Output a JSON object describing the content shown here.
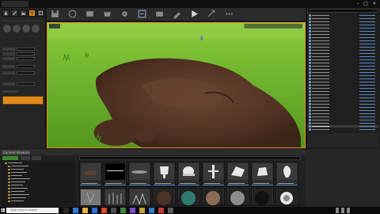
{
  "window": {
    "tab_label": "",
    "buttons": [
      "minimize",
      "maximize",
      "close"
    ]
  },
  "modes_panel": {
    "mode_icons": [
      "place-icon",
      "paint-icon",
      "landscape-icon",
      "foliage-icon",
      "geometry-icon"
    ],
    "active_mode": "foliage-icon"
  },
  "toolbar": {
    "icons": [
      "save-icon",
      "source-control-icon",
      "content-icon",
      "marketplace-icon",
      "settings-icon",
      "blueprints-icon",
      "cinematics-icon",
      "build-icon",
      "play-icon",
      "launch-icon"
    ]
  },
  "content_browser": {
    "tab_label": "Content Browser",
    "assets_row1": [
      "mesh-dark",
      "mesh-black",
      "mesh-flat",
      "mesh-white-1",
      "mesh-white-2",
      "mesh-white-3",
      "mesh-white-4",
      "mesh-white-5",
      "mesh-white-6"
    ],
    "assets_row2": [
      "material-grey",
      "material-plants",
      "material-gravel",
      "material-sphere-dark",
      "material-sphere-teal",
      "material-sphere-rock",
      "material-sphere-metal",
      "material-sphere-black",
      "material-sphere-light"
    ]
  },
  "taskbar": {
    "search_placeholder": "Type here to search",
    "time": "",
    "date": ""
  },
  "colors": {
    "accent": "#e08a1e",
    "grass": "#6fb52c",
    "dirt": "#5a3826",
    "panel": "#252525"
  }
}
